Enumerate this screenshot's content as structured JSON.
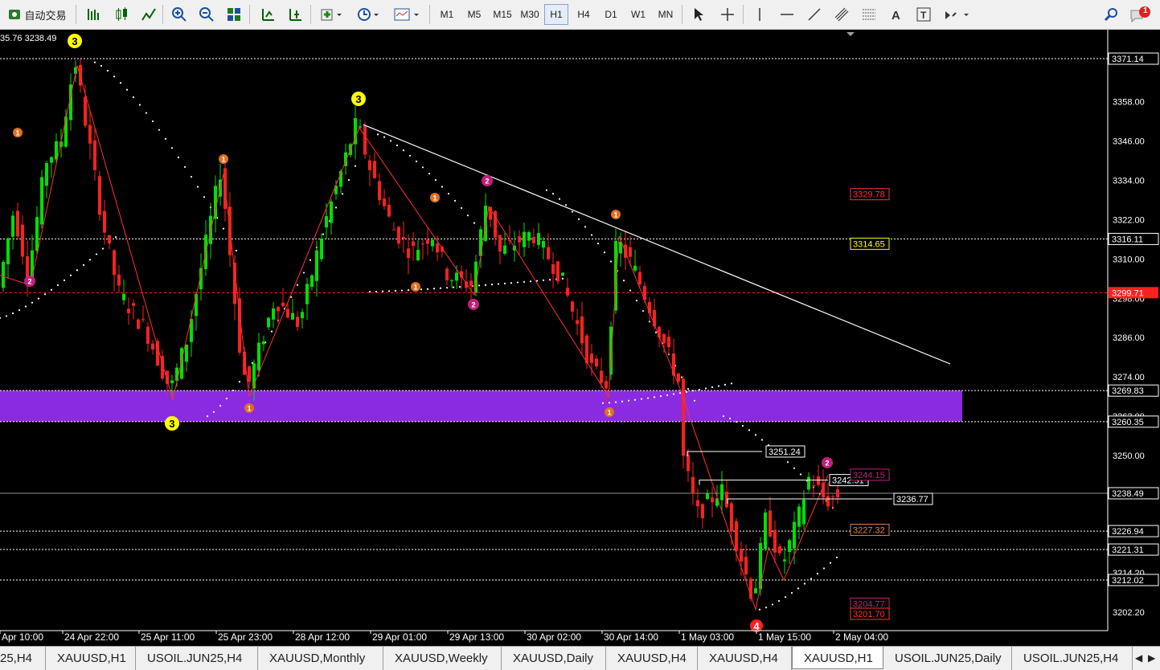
{
  "toolbar": {
    "autotrade_label": "自动交易",
    "timeframes": [
      "M1",
      "M5",
      "M15",
      "M30",
      "H1",
      "H4",
      "D1",
      "W1",
      "MN"
    ],
    "active_timeframe": "H1",
    "notification_count": "1"
  },
  "chart": {
    "info_text": "35.76 3238.49",
    "price_axis_labels": [
      "3358.00",
      "3346.00",
      "3334.00",
      "3322.00",
      "3310.00",
      "3298.00",
      "3286.00",
      "3274.00",
      "3262.00",
      "3250.00",
      "3214.20",
      "3202.20"
    ],
    "time_axis_labels": [
      "Apr 10:00",
      "24 Apr 22:00",
      "25 Apr 11:00",
      "25 Apr 23:00",
      "28 Apr 12:00",
      "29 Apr 01:00",
      "29 Apr 13:00",
      "30 Apr 02:00",
      "30 Apr 14:00",
      "1 May 03:00",
      "1 May 15:00",
      "2 May 04:00"
    ],
    "level_lines": [
      "3371.14",
      "3316.11",
      "3269.83",
      "3260.35",
      "3226.94",
      "3221.31",
      "3212.02"
    ],
    "bid_price": "3238.49",
    "red_line_price": "3299.71",
    "in_chart_labels": [
      "3329.78",
      "3314.65",
      "3251.24",
      "3242.51",
      "3236.77",
      "3227.32",
      "3204.77",
      "3201.70",
      "3244.15"
    ],
    "wave_markers": [
      "3",
      "3",
      "3",
      "2",
      "2",
      "2",
      "2",
      "1",
      "1",
      "1",
      "1",
      "1",
      "1",
      "1",
      "4"
    ]
  },
  "tabs": [
    "25,H4",
    "XAUUSD,H1",
    "USOIL.JUN25,H4",
    "XAUUSD,Monthly",
    "XAUUSD,Weekly",
    "XAUUSD,Daily",
    "XAUUSD,H4",
    "XAUUSD,H4",
    "XAUUSD,H1",
    "USOIL.JUN25,Daily",
    "USOIL.JUN25,H4"
  ],
  "active_tab": 8,
  "colors": {
    "background": "#000000",
    "bull_candle": "#00e000",
    "bear_candle": "#ff2020",
    "zone": "#8a2be2",
    "zigzag": "#ff3030",
    "trendline": "#ffffff",
    "sar_dots": "#ffffff",
    "marker_yellow": "#ffff00",
    "marker_orange": "#e07020",
    "marker_magenta": "#c0207a"
  }
}
